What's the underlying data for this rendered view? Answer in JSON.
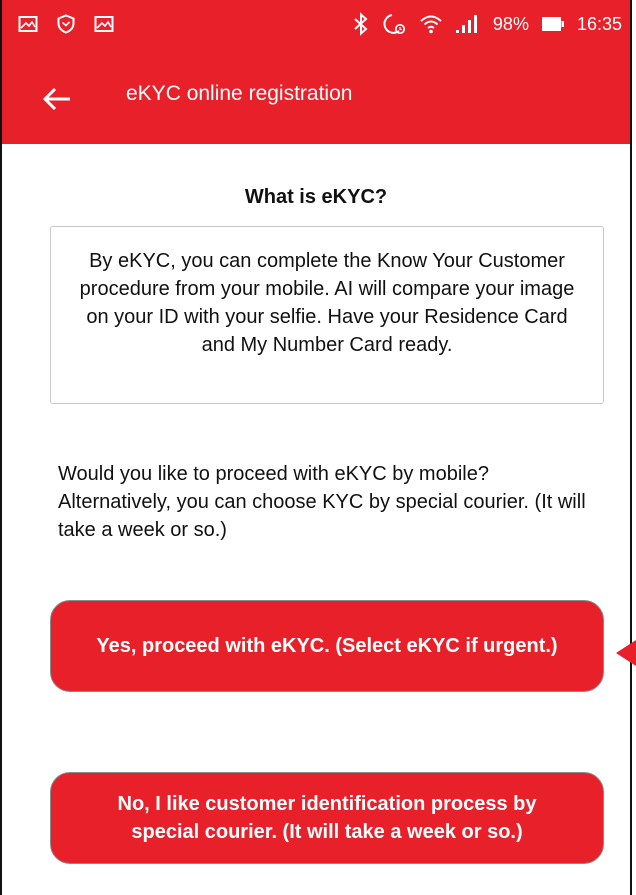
{
  "status_bar": {
    "left_icons": [
      "image-icon",
      "shield-icon",
      "image-icon"
    ],
    "right_icons": [
      "bluetooth-icon",
      "alarm-icon",
      "wifi-icon",
      "signal-icon",
      "battery-icon"
    ],
    "battery": "98%",
    "time": "16:35"
  },
  "app_bar": {
    "back_icon": "arrow-left-icon",
    "title": "eKYC online registration"
  },
  "content": {
    "heading": "What is eKYC?",
    "description": "By eKYC, you can complete the Know Your Customer procedure from your mobile. AI will compare your image on your ID with your selfie.  Have your Residence Card and My Number Card ready.",
    "prompt": "Would you like to proceed with eKYC by mobile? Alternatively, you can choose KYC by special courier. (It will take a week or so.)"
  },
  "buttons": {
    "yes_label": "Yes, proceed with eKYC. (Select eKYC if urgent.)",
    "no_label": "No, I like customer identification process by special courier. (It will take a week or so.)"
  },
  "colors": {
    "accent": "#e8202a",
    "text": "#111111",
    "border": "#c9c9c9"
  }
}
